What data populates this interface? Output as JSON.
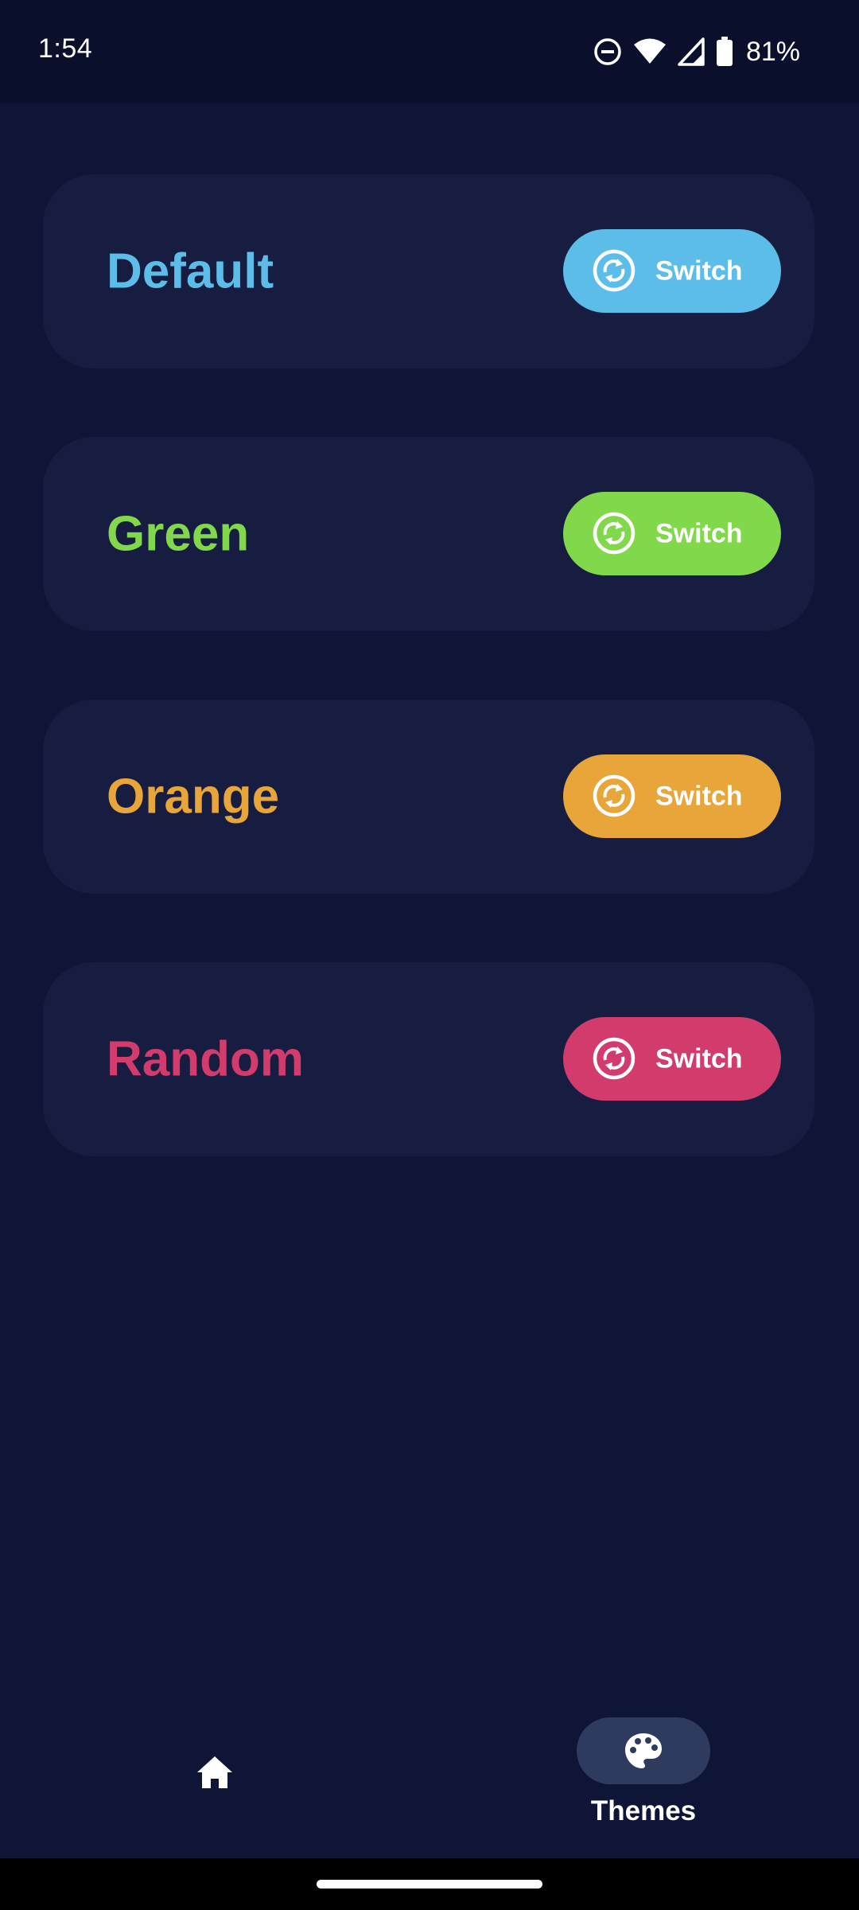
{
  "status_bar": {
    "time": "1:54",
    "battery": "81%",
    "icons": [
      "do-not-disturb-icon",
      "wifi-icon",
      "signal-icon",
      "battery-icon"
    ]
  },
  "themes": [
    {
      "name": "Default",
      "button_label": "Switch",
      "color": "#5dbde9"
    },
    {
      "name": "Green",
      "button_label": "Switch",
      "color": "#80d84a"
    },
    {
      "name": "Orange",
      "button_label": "Switch",
      "color": "#e8a53a"
    },
    {
      "name": "Random",
      "button_label": "Switch",
      "color": "#d23c6d"
    }
  ],
  "bottom_nav": {
    "items": [
      {
        "icon": "home-icon",
        "label": "",
        "active": false
      },
      {
        "icon": "palette-icon",
        "label": "Themes",
        "active": true
      }
    ]
  },
  "colors": {
    "background": "#0e1537",
    "card": "#161d40",
    "status_bar": "#0a0f2c",
    "nav_indicator": "#2e3a5e"
  }
}
